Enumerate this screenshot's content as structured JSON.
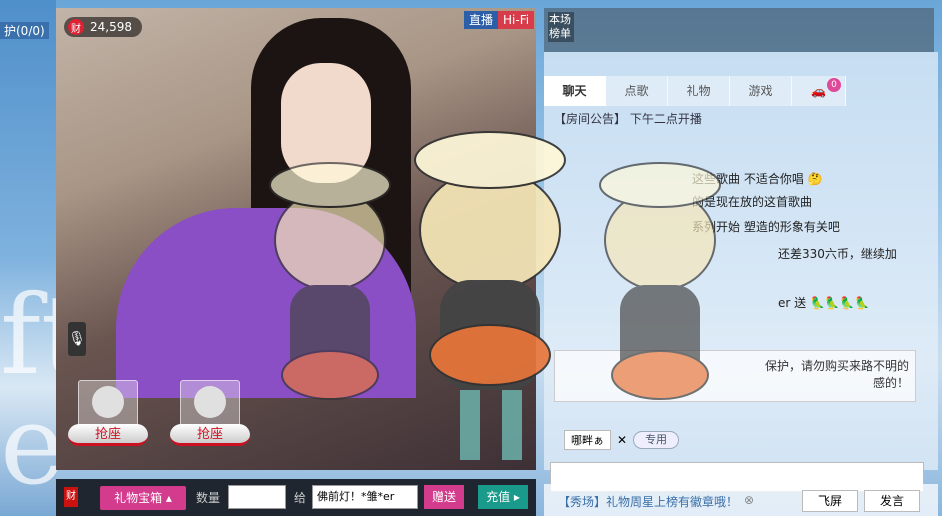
{
  "left_strip": {
    "label": "护(0/0)",
    "bg_text": "ft\ne"
  },
  "wealth": {
    "icon_text": "财",
    "value": "24,598"
  },
  "broadcast": {
    "mode": "直播",
    "quality": "Hi-Fi"
  },
  "ranking": {
    "label": "本场榜单"
  },
  "tabs": [
    {
      "label": "聊天",
      "active": true
    },
    {
      "label": "点歌"
    },
    {
      "label": "礼物"
    },
    {
      "label": "游戏"
    }
  ],
  "car_badge": "0",
  "chat": {
    "announcement": "【房间公告】 下午二点开播",
    "messages": [
      "这些歌曲 不适合你唱 🤔",
      "的是现在放的这首歌曲",
      "系列开始 塑造的形象有关吧",
      "还差330六币，继续加",
      "er 送 🦜🦜🦜🦜"
    ],
    "notice_text": "保护，请勿购买来路不明的\n感的！",
    "target": "哪畔ぁ",
    "private_label": "专用"
  },
  "seats": [
    {
      "label": "抢座"
    },
    {
      "label": "抢座"
    }
  ],
  "toolbar": {
    "wealth_icon": "财",
    "giftbox": "礼物宝箱 ▴",
    "qty_label": "数量",
    "give_label": "给",
    "recipient": "佛前灯！*雏*er",
    "send": "赠送",
    "recharge": "充值 ▸"
  },
  "bottom": {
    "notice": "【秀场】礼物周星上榜有徽章哦！",
    "close": "⊗",
    "flyscreen": "飞屏",
    "send": "发言"
  }
}
